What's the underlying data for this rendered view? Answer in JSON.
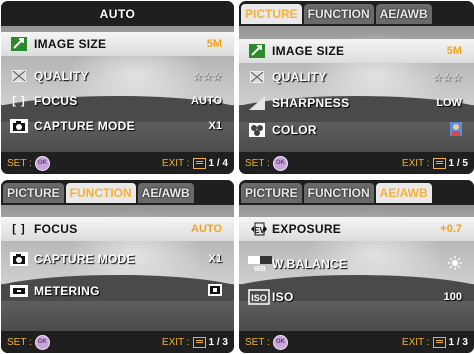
{
  "panels": [
    {
      "header_title": "AUTO",
      "rows": [
        {
          "label": "IMAGE SIZE",
          "value": "5M",
          "icon": "image-size-icon"
        },
        {
          "label": "QUALITY",
          "value": "☆☆☆",
          "icon": "quality-icon"
        },
        {
          "label": "FOCUS",
          "value": "AUTO",
          "icon": "focus-icon"
        },
        {
          "label": "CAPTURE MODE",
          "value": "X1",
          "icon": "capture-mode-icon"
        }
      ],
      "footer": {
        "set": "SET :",
        "ok": "OK",
        "exit": "EXIT :",
        "page": "1 / 4"
      }
    },
    {
      "tabs": [
        "PICTURE",
        "FUNCTION",
        "AE/AWB"
      ],
      "rows": [
        {
          "label": "IMAGE SIZE",
          "value": "5M",
          "icon": "image-size-icon"
        },
        {
          "label": "QUALITY",
          "value": "☆☆☆",
          "icon": "quality-icon"
        },
        {
          "label": "SHARPNESS",
          "value": "LOW",
          "icon": "sharpness-icon"
        },
        {
          "label": "COLOR",
          "value": "",
          "icon": "color-icon"
        }
      ],
      "footer": {
        "set": "SET :",
        "ok": "OK",
        "exit": "EXIT :",
        "page": "1 / 5"
      }
    },
    {
      "tabs": [
        "PICTURE",
        "FUNCTION",
        "AE/AWB"
      ],
      "rows": [
        {
          "label": "FOCUS",
          "value": "AUTO",
          "icon": "focus-icon"
        },
        {
          "label": "CAPTURE MODE",
          "value": "X1",
          "icon": "capture-mode-icon"
        },
        {
          "label": "METERING",
          "value": "",
          "icon": "metering-icon"
        }
      ],
      "footer": {
        "set": "SET :",
        "ok": "OK",
        "exit": "EXIT :",
        "page": "1 / 3"
      }
    },
    {
      "tabs": [
        "PICTURE",
        "FUNCTION",
        "AE/AWB"
      ],
      "rows": [
        {
          "label": "EXPOSURE",
          "value": "+0.7",
          "icon": "exposure-icon"
        },
        {
          "label": "W.BALANCE",
          "value": "",
          "icon": "white-balance-icon"
        },
        {
          "label": "ISO",
          "value": "100",
          "icon": "iso-icon"
        }
      ],
      "footer": {
        "set": "SET :",
        "ok": "OK",
        "exit": "EXIT :",
        "page": "1 / 3"
      }
    }
  ],
  "colors": {
    "accent": "#f2b13a",
    "selected_row": "#e6e6e6",
    "footer_text": "#f4b02f"
  }
}
